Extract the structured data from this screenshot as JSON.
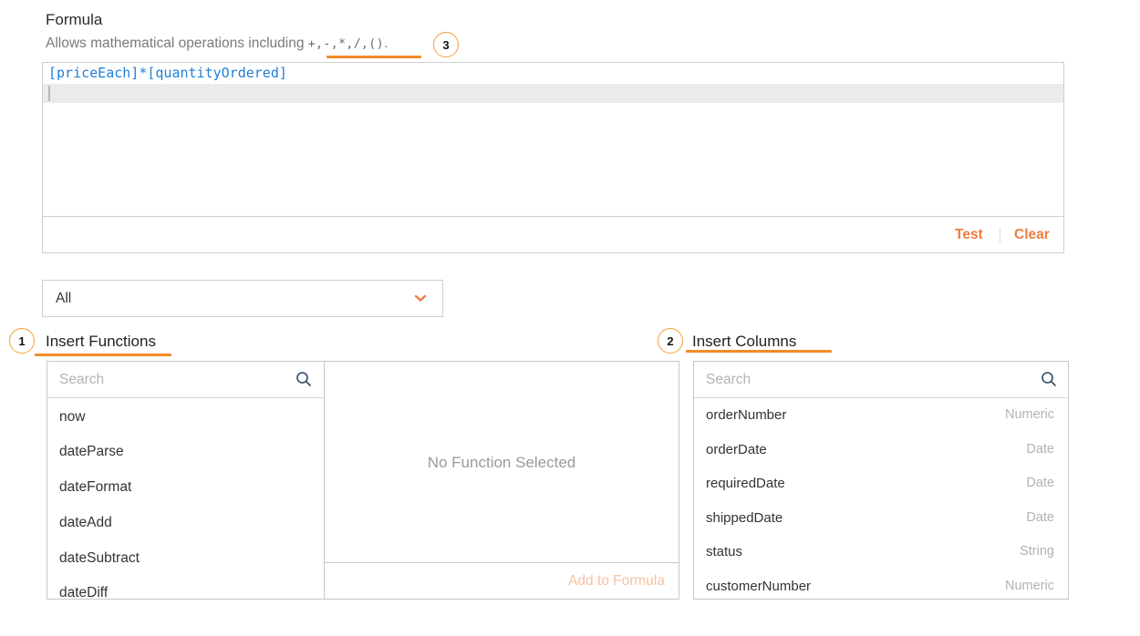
{
  "formula": {
    "title": "Formula",
    "description_prefix": "Allows mathematical operations including ",
    "operators": "+,-,*,/,()",
    "description_suffix": ".",
    "expression": "[priceEach]*[quantityOrdered]",
    "test_label": "Test",
    "clear_label": "Clear"
  },
  "category_select": {
    "value": "All"
  },
  "badges": {
    "functions": "1",
    "columns": "2",
    "operators": "3"
  },
  "functions": {
    "title": "Insert Functions",
    "search_placeholder": "Search",
    "items": [
      "now",
      "dateParse",
      "dateFormat",
      "dateAdd",
      "dateSubtract",
      "dateDiff"
    ],
    "empty_message": "No Function Selected",
    "add_label": "Add to Formula"
  },
  "columns": {
    "title": "Insert Columns",
    "search_placeholder": "Search",
    "items": [
      {
        "name": "orderNumber",
        "type": "Numeric"
      },
      {
        "name": "orderDate",
        "type": "Date"
      },
      {
        "name": "requiredDate",
        "type": "Date"
      },
      {
        "name": "shippedDate",
        "type": "Date"
      },
      {
        "name": "status",
        "type": "String"
      },
      {
        "name": "customerNumber",
        "type": "Numeric"
      }
    ]
  },
  "colors": {
    "accent": "#ef7c3f",
    "highlight": "#f28c28",
    "expression": "#1f7fd8"
  },
  "icons": [
    "search-icon",
    "chevron-down-icon"
  ]
}
